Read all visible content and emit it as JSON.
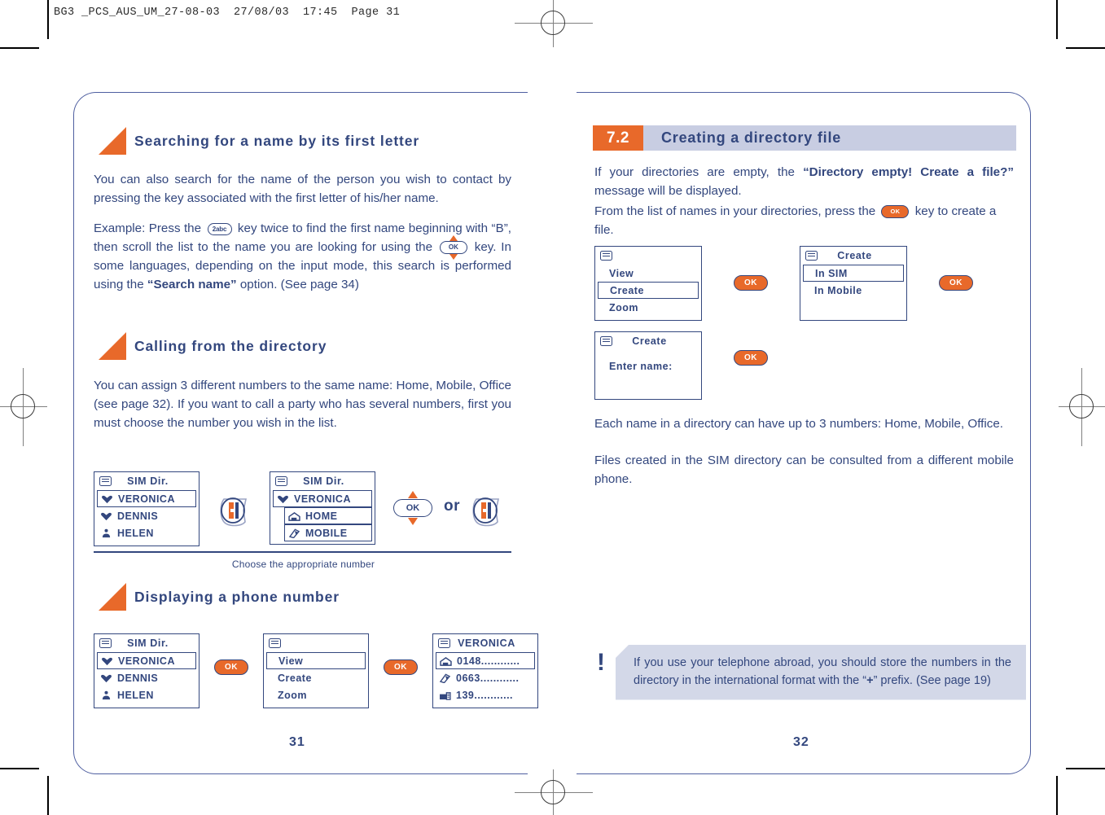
{
  "print": {
    "filename_line": "BG3 _PCS_AUS_UM_27-08-03  27/08/03  17:45  Page 31"
  },
  "left_page": {
    "page_number": "31",
    "sections": [
      {
        "title": "Searching for a name by its first letter",
        "paragraphs": [
          "You can also search for the name of the person you wish to contact by pressing the key associated with the first letter of his/her name."
        ]
      },
      {
        "title": "Calling from the directory",
        "paragraphs": [
          "You can assign 3 different numbers to the same name: Home, Mobile, Office (see page 32). If you want to call a party who has several numbers, first you must choose the number you wish in the list."
        ]
      },
      {
        "title": "Displaying a phone number"
      }
    ],
    "example_text": {
      "part1": "Example: Press the",
      "part2": "key twice to find the first name beginning with “B”, then scroll the list to the name you are looking for using the",
      "part3": "key. In some languages, depending on the input mode, this search is performed using the",
      "search_name_bold": "“Search name”",
      "part4": "option. (See page 34)"
    },
    "key_labels": {
      "two_abc": "2abc",
      "ok": "OK"
    },
    "calling_flow": {
      "screen1": {
        "title": "SIM Dir.",
        "rows": [
          {
            "label": "VERONICA",
            "icon": "heart-phone-icon",
            "selected": true
          },
          {
            "label": "DENNIS",
            "icon": "heart-phone-icon",
            "selected": false
          },
          {
            "label": "HELEN",
            "icon": "person-icon",
            "selected": false
          }
        ]
      },
      "screen2": {
        "title": "SIM Dir.",
        "rows": [
          {
            "label": "VERONICA",
            "icon": "heart-phone-icon",
            "selected": true
          },
          {
            "label": "HOME",
            "icon": "home-icon",
            "selected": true
          },
          {
            "label": "MOBILE",
            "icon": "mobile-icon",
            "selected": true
          }
        ]
      },
      "or_label": "or",
      "caption": "Choose the appropriate number"
    },
    "display_flow": {
      "screen1": {
        "title": "SIM Dir.",
        "rows": [
          {
            "label": "VERONICA",
            "icon": "heart-phone-icon",
            "selected": true
          },
          {
            "label": "DENNIS",
            "icon": "heart-phone-icon",
            "selected": false
          },
          {
            "label": "HELEN",
            "icon": "person-icon",
            "selected": false
          }
        ]
      },
      "screen2": {
        "title": "",
        "rows": [
          {
            "label": "View",
            "selected": true
          },
          {
            "label": "Create",
            "selected": false
          },
          {
            "label": "Zoom",
            "selected": false
          }
        ]
      },
      "screen3": {
        "title": "VERONICA",
        "rows": [
          {
            "label": "0148............",
            "icon": "home-icon",
            "selected": true
          },
          {
            "label": "0663............",
            "icon": "mobile-icon",
            "selected": false
          },
          {
            "label": "139............",
            "icon": "office-icon",
            "selected": false
          }
        ]
      },
      "ok_label": "OK"
    }
  },
  "right_page": {
    "page_number": "32",
    "chapter": {
      "number": "7.2",
      "title": "Creating a directory file"
    },
    "intro": {
      "line1_a": "If your directories are empty, the",
      "line1_bold": "“Directory empty! Create a file?”",
      "line1_b": "message will be displayed.",
      "line2_a": "From the list of names in your directories, press the",
      "line2_b": "key to create a file."
    },
    "create_flow": {
      "screen1": {
        "title": "",
        "rows": [
          {
            "label": "View",
            "selected": false
          },
          {
            "label": "Create",
            "selected": true
          },
          {
            "label": "Zoom",
            "selected": false
          }
        ]
      },
      "screen2": {
        "title": "Create",
        "rows": [
          {
            "label": "In SIM",
            "selected": true
          },
          {
            "label": "In Mobile",
            "selected": false
          }
        ]
      },
      "screen3": {
        "title": "Create",
        "rows": [
          {
            "label": "Enter name:",
            "selected": false
          }
        ]
      },
      "ok_label": "OK"
    },
    "paragraphs": [
      "Each name in a directory can have up to 3 numbers: Home, Mobile, Office.",
      "Files created in the SIM directory can be consulted from a different mobile phone."
    ],
    "note": {
      "marker": "!",
      "text_a": "If you use your telephone abroad, you should store the numbers in the directory in the international format with the “",
      "plus": "+",
      "text_b": "” prefix. (See page 19)"
    }
  },
  "colors": {
    "navy": "#33477e",
    "orange": "#e8692a",
    "chapter_bar": "#c8cde2",
    "note_bg": "#d3d8e8"
  }
}
